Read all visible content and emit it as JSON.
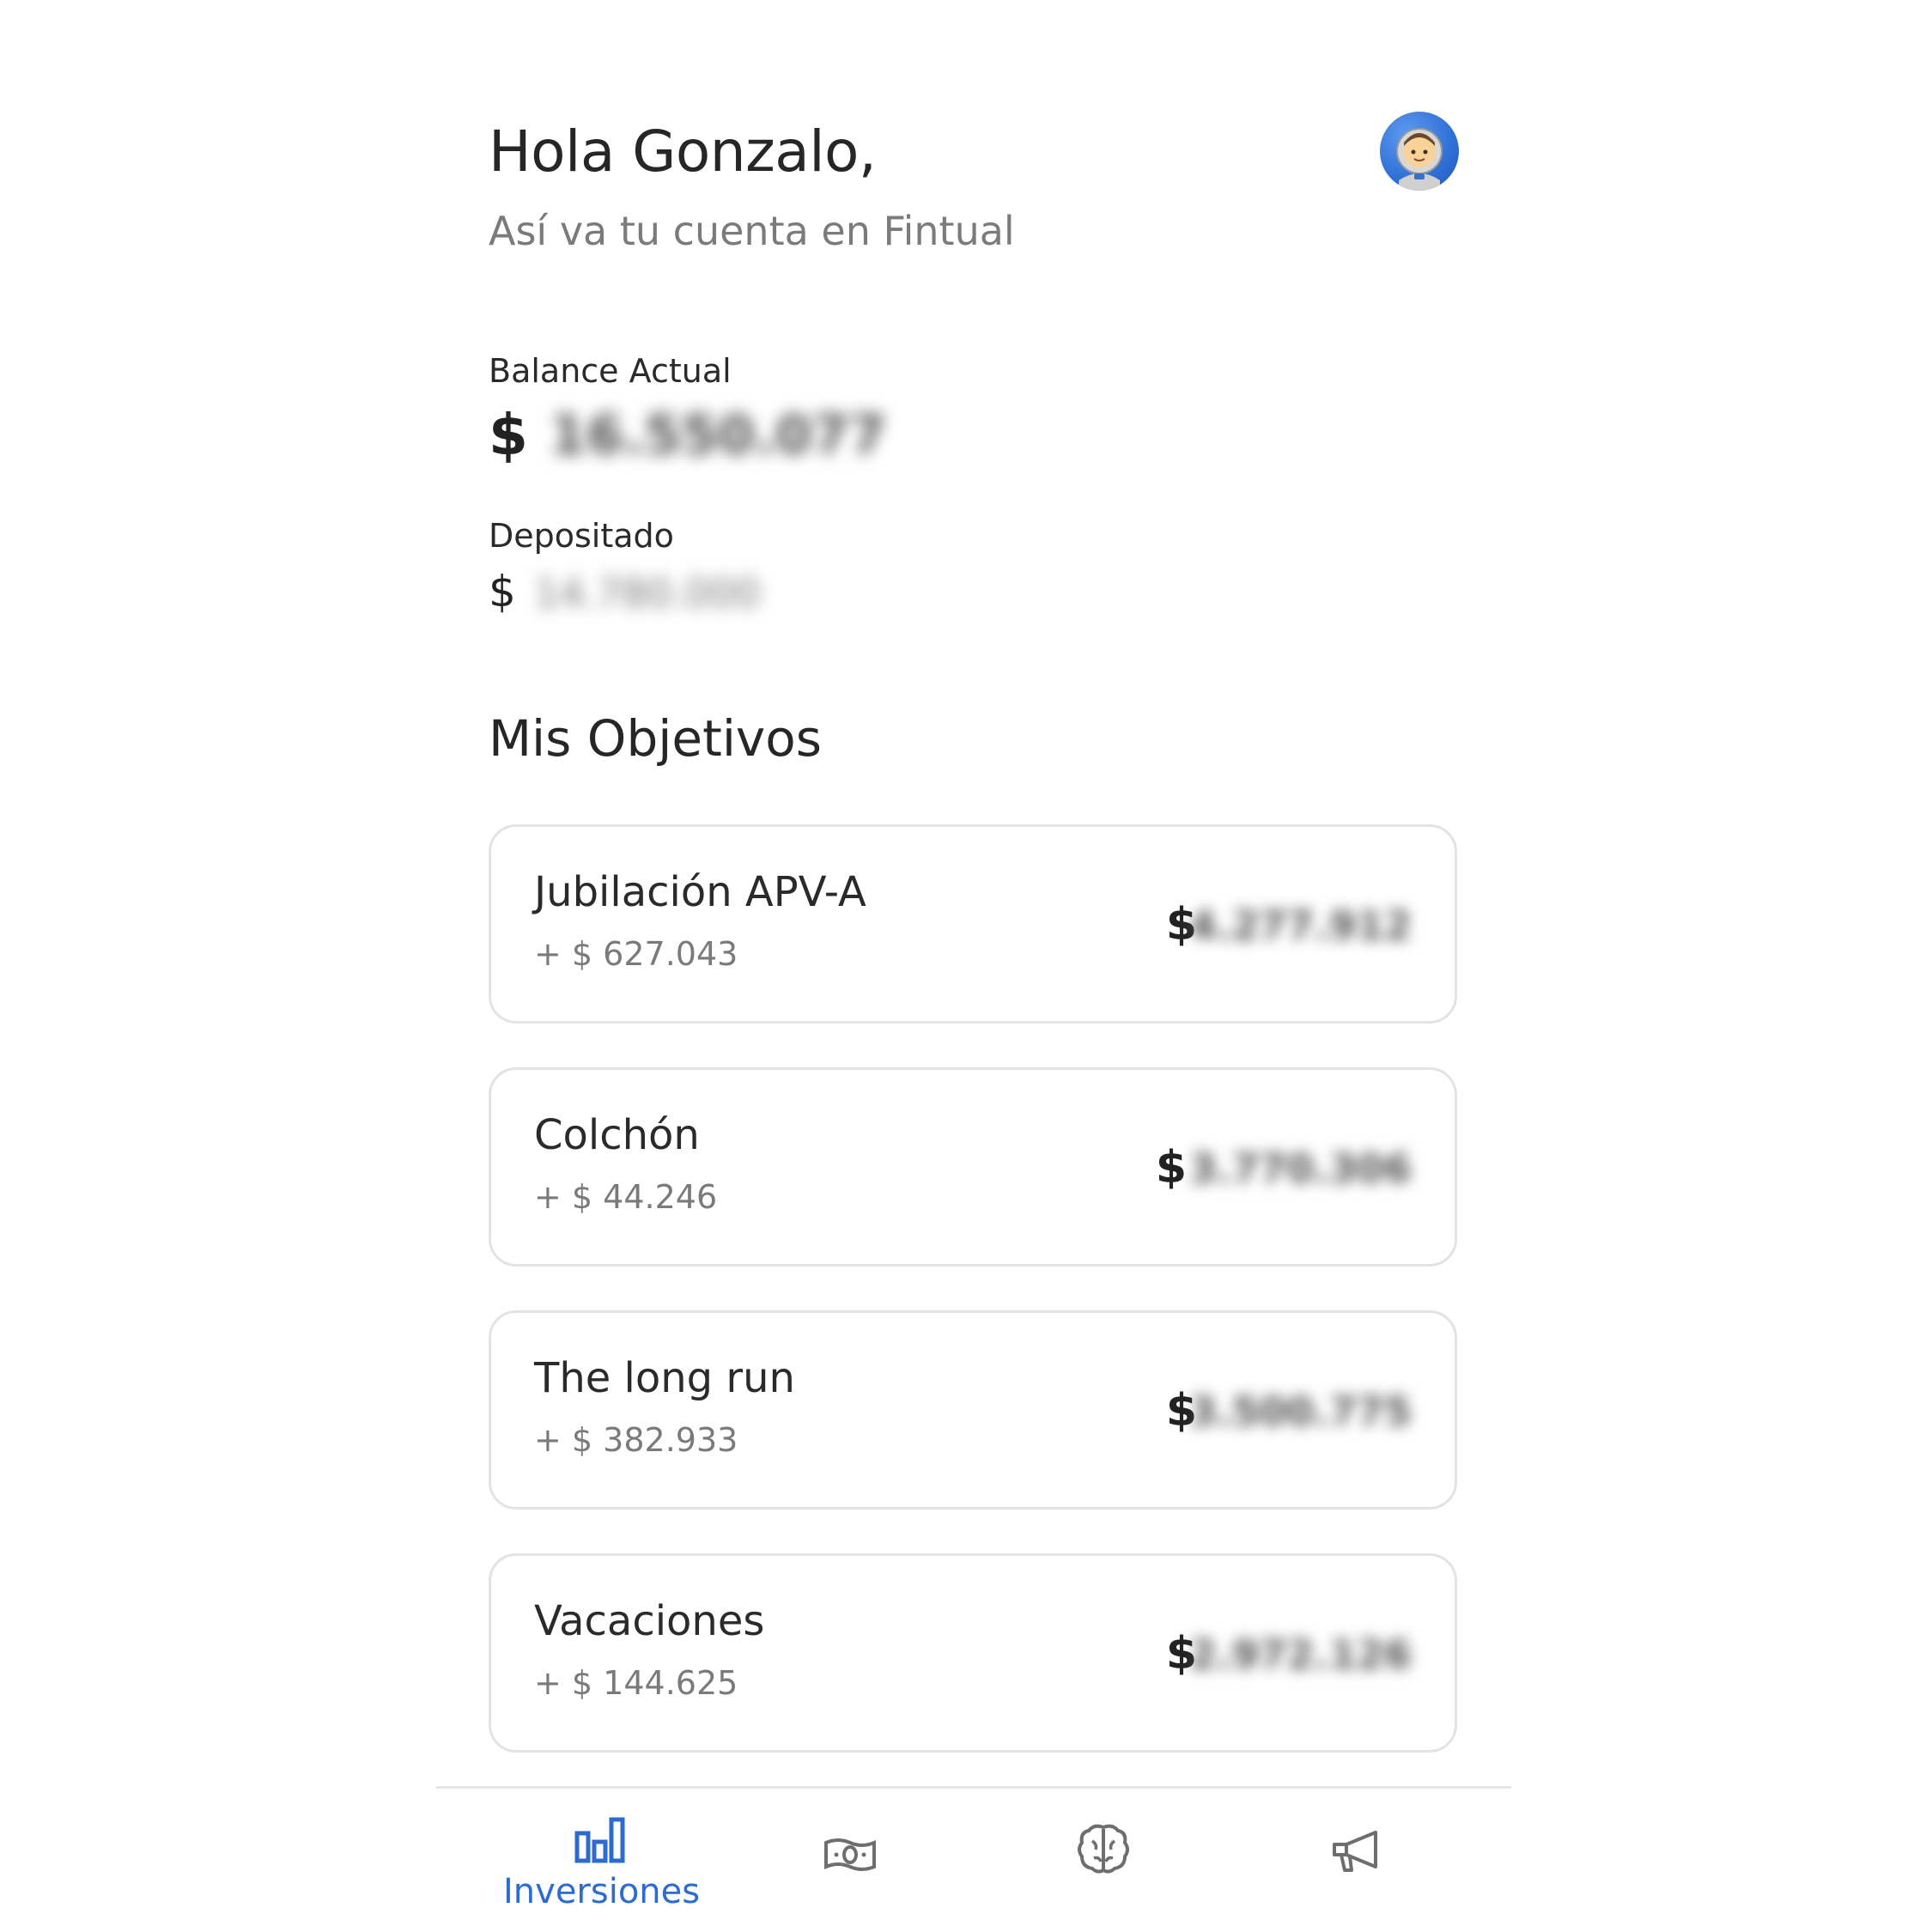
{
  "header": {
    "greeting": "Hola Gonzalo,",
    "subtitle": "Así va tu cuenta en Fintual",
    "avatar_icon": "astronaut-avatar-icon"
  },
  "summary": {
    "balance_label": "Balance Actual",
    "balance_currency": "$",
    "balance_value": "16.550.077",
    "deposit_label": "Depositado",
    "deposit_currency": "$",
    "deposit_value": "14.780.000"
  },
  "goals_section": {
    "title": "Mis Objetivos",
    "goals": [
      {
        "name": "Jubilación APV-A",
        "gain": "+ $ 627.043",
        "currency": "$",
        "value": "4.277.912"
      },
      {
        "name": "Colchón",
        "gain": "+ $ 44.246",
        "currency": "$",
        "value": "3.770.306"
      },
      {
        "name": "The long run",
        "gain": "+ $ 382.933",
        "currency": "$",
        "value": "3.500.775"
      },
      {
        "name": "Vacaciones",
        "gain": "+ $ 144.625",
        "currency": "$",
        "value": "2.972.126"
      }
    ]
  },
  "bottom_nav": {
    "items": [
      {
        "icon": "bar-chart-icon",
        "label": "Inversiones",
        "active": true
      },
      {
        "icon": "money-bill-icon",
        "label": "",
        "active": false
      },
      {
        "icon": "brain-icon",
        "label": "",
        "active": false
      },
      {
        "icon": "megaphone-icon",
        "label": "",
        "active": false
      }
    ],
    "active_color": "#2d6bd3",
    "inactive_color": "#6e6e6e"
  }
}
